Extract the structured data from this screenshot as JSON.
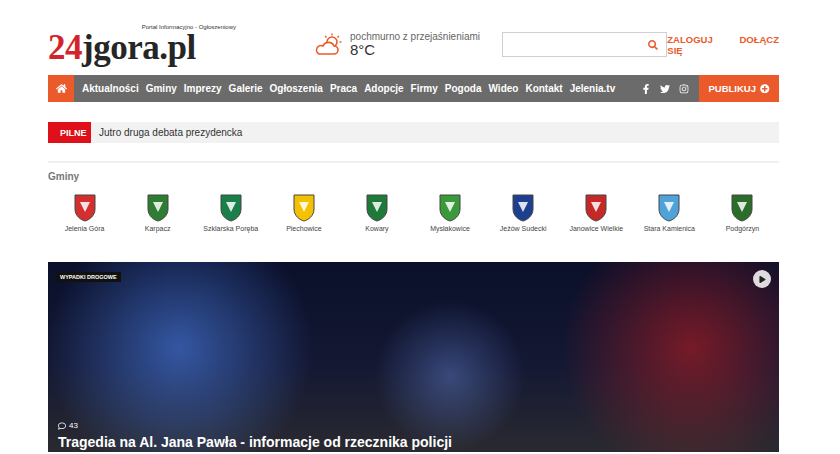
{
  "logo": {
    "prefix": "24",
    "name": "jgora.pl",
    "tagline": "Portal Informacyjno - Ogłoszeniowy"
  },
  "weather": {
    "description": "pochmurno z przejaśnieniami",
    "temperature": "8°C"
  },
  "account": [
    "ZALOGUJ SIĘ",
    "DOŁĄCZ"
  ],
  "nav": {
    "home": {
      "selected": true
    },
    "items": [
      {
        "label": "Aktualności",
        "selected": false
      },
      {
        "label": "Gminy",
        "selected": false
      },
      {
        "label": "Imprezy",
        "selected": false
      },
      {
        "label": "Galerie",
        "selected": false
      },
      {
        "label": "Ogłoszenia",
        "selected": false
      },
      {
        "label": "Praca",
        "selected": false
      },
      {
        "label": "Adopcje",
        "selected": false
      },
      {
        "label": "Firmy",
        "selected": false
      },
      {
        "label": "Pogoda",
        "selected": false
      },
      {
        "label": "Wideo",
        "selected": false
      },
      {
        "label": "Kontakt",
        "selected": false
      },
      {
        "label": "Jelenia.tv",
        "selected": false
      }
    ],
    "publish": "PUBLIKUJ"
  },
  "breaking": {
    "label": "PILNE",
    "text": "Jutro druga debata prezydencka"
  },
  "municipalities": {
    "title": "Gminy",
    "items": [
      {
        "name": "Jelenia Góra",
        "color": "#d32f2f"
      },
      {
        "name": "Karpacz",
        "color": "#2e7d32"
      },
      {
        "name": "Szklarska Poręba",
        "color": "#1b7f4a"
      },
      {
        "name": "Piechowice",
        "color": "#f2c200"
      },
      {
        "name": "Kowary",
        "color": "#1f7a3a"
      },
      {
        "name": "Mysłakowice",
        "color": "#3a9a3a"
      },
      {
        "name": "Jeżów Sudecki",
        "color": "#1e3f8f"
      },
      {
        "name": "Janowice Wielkie",
        "color": "#c62828"
      },
      {
        "name": "Stara Kamienica",
        "color": "#4fa3d9"
      },
      {
        "name": "Podgórzyn",
        "color": "#2b6e2b"
      }
    ]
  },
  "featured": {
    "category": "WYPADKI DROGOWE",
    "comments": "43",
    "title": "Tragedia na Al. Jana Pawła - informacje od rzecznika policji"
  }
}
